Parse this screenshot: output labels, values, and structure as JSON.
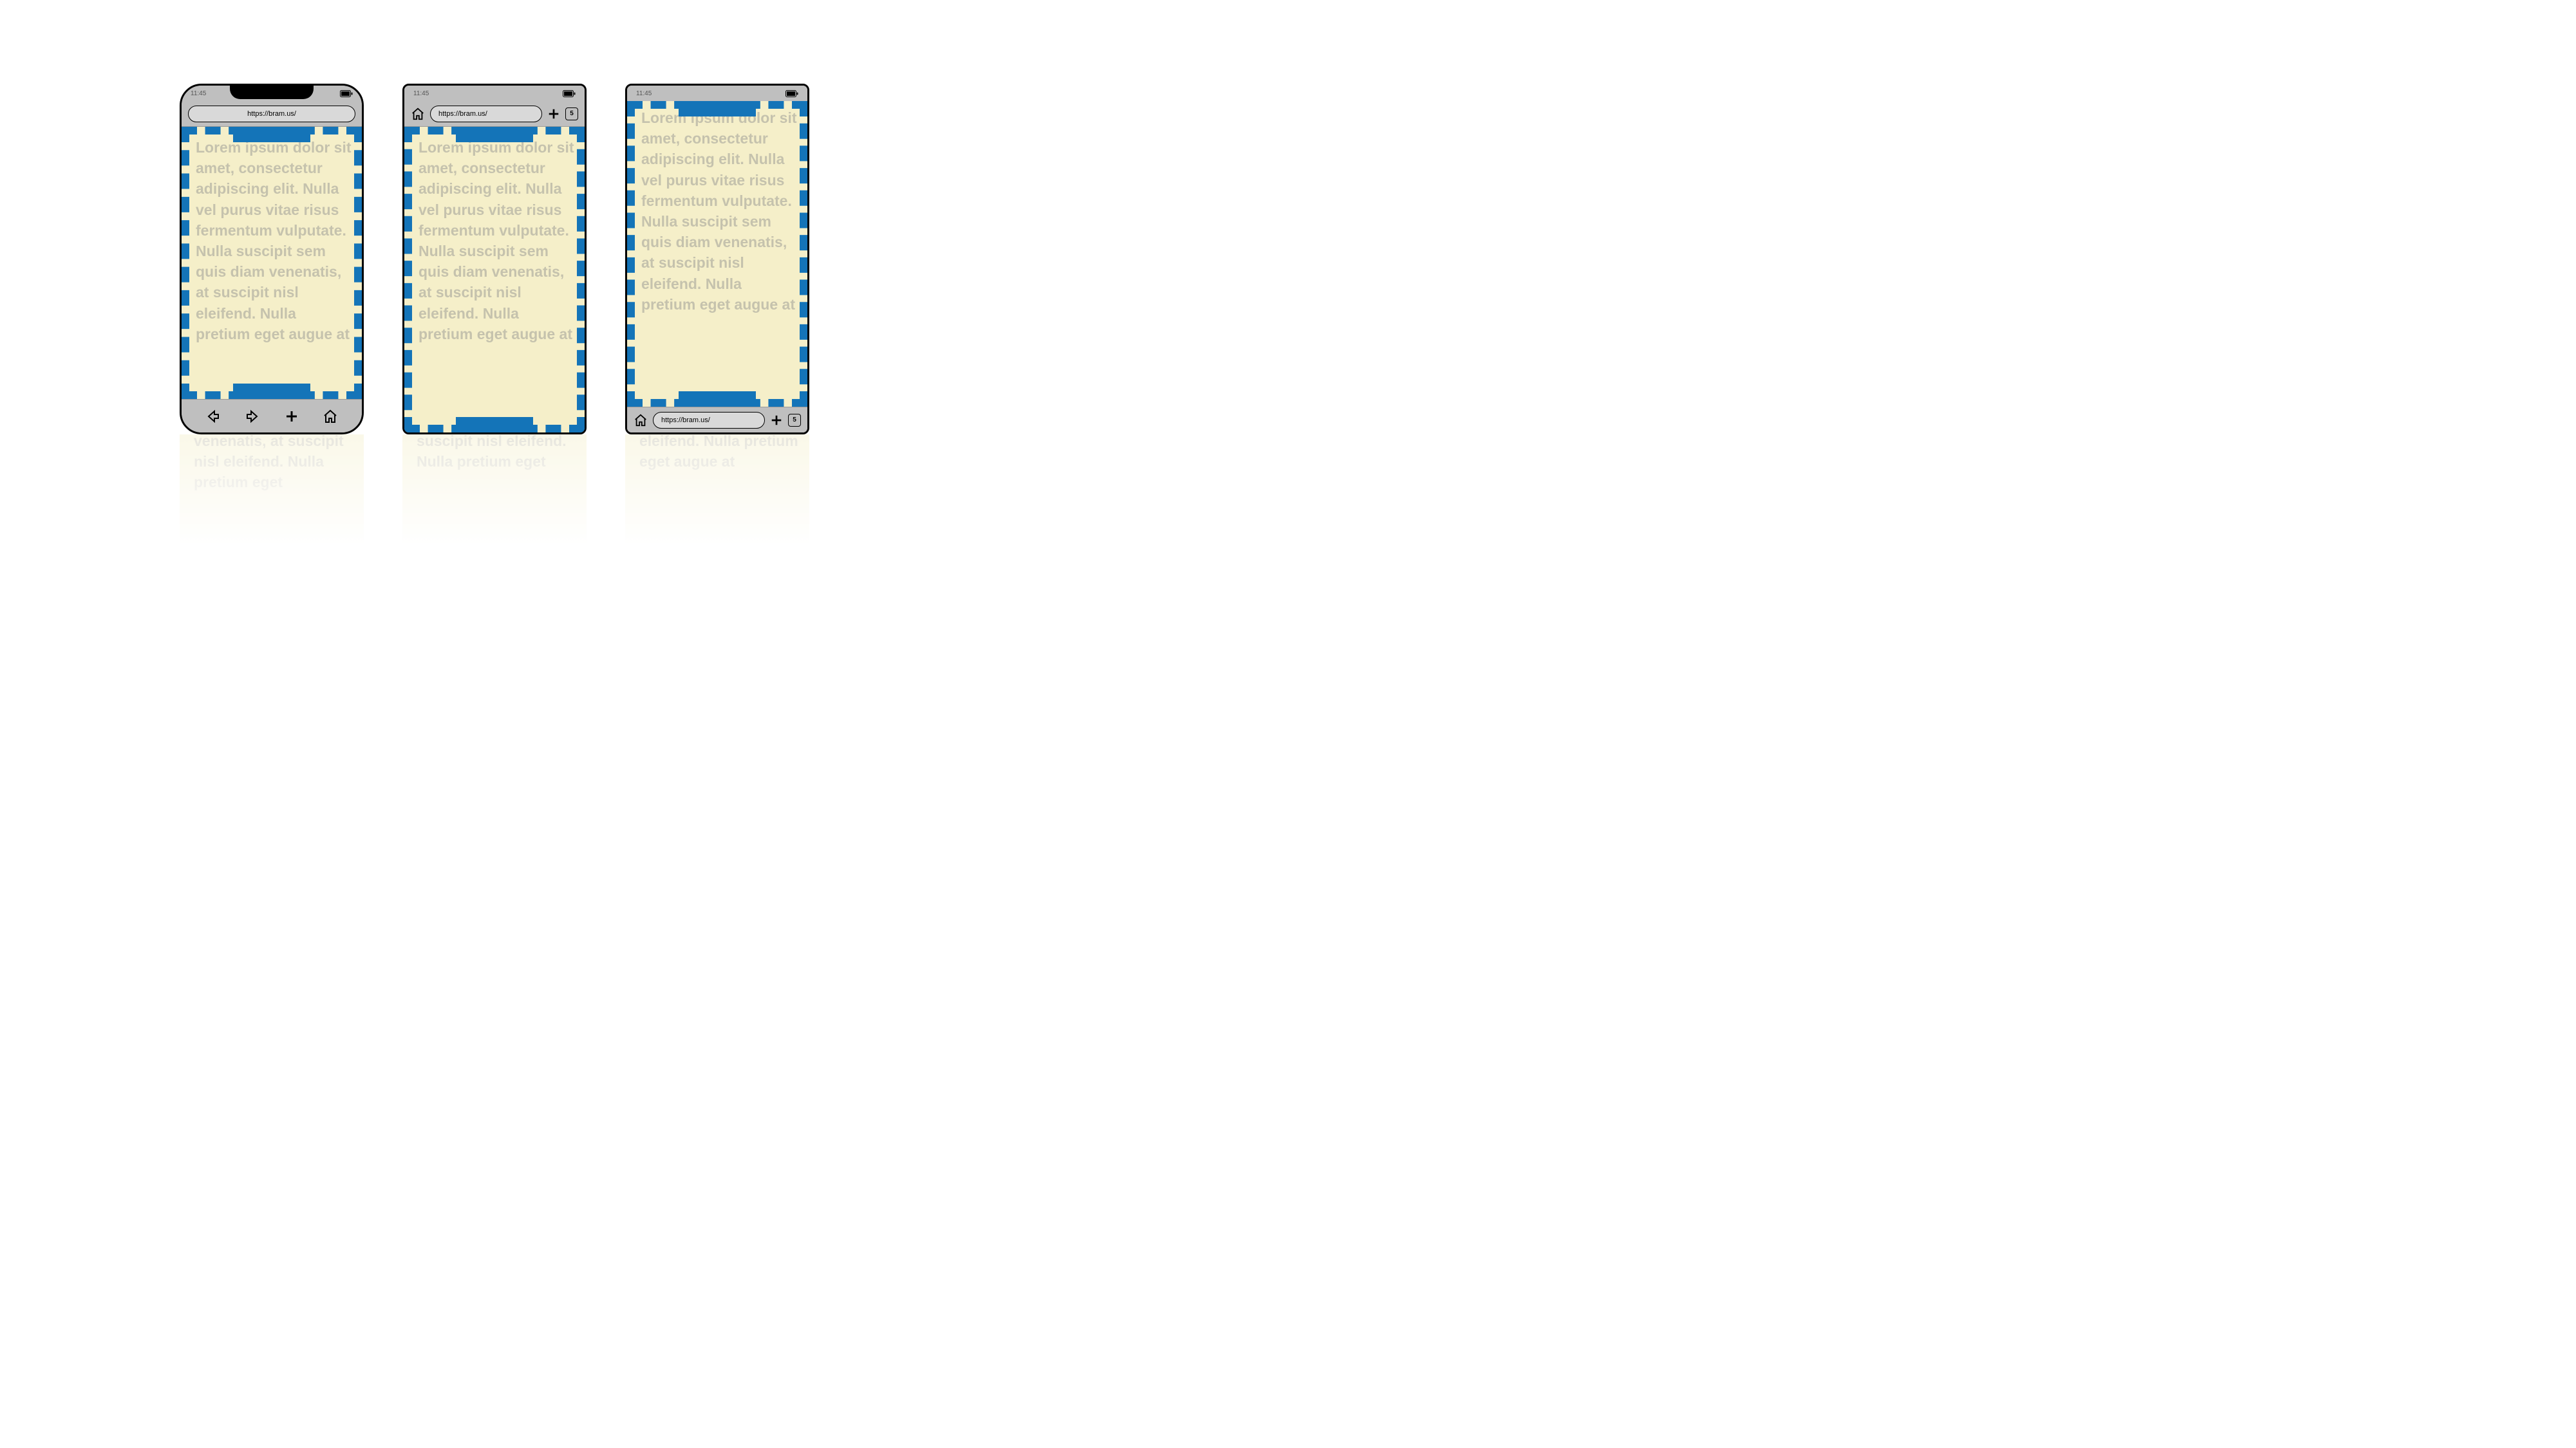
{
  "status": {
    "time": "11:45"
  },
  "url": "https://bram.us/",
  "tab_count": "5",
  "lorem": "Lorem ipsum dolor sit amet, consectetur adipiscing elit. Nulla vel purus vitae risus fermentum vulputate. Nulla suscipit sem quis diam venenatis, at suscipit nisl eleifend. Nulla pretium eget augue at",
  "reflection_a": "venenatis, at suscipit nisl eleifend. Nulla pretium eget",
  "reflection_b": "suscipit nisl eleifend. Nulla pretium eget",
  "reflection_c": "eleifend. Nulla pretium eget augue at"
}
